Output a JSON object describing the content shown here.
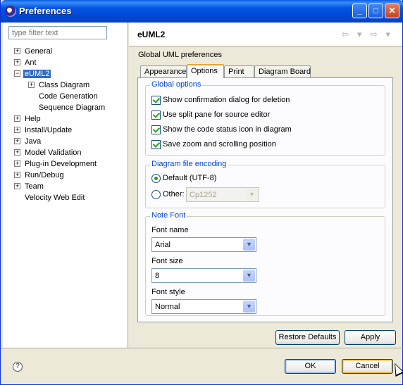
{
  "window": {
    "title": "Preferences",
    "min_label": "_",
    "max_label": "□",
    "close_label": "✕"
  },
  "filter": {
    "placeholder": "type filter text"
  },
  "tree": {
    "items": [
      {
        "label": "General",
        "expander": "+"
      },
      {
        "label": "Ant",
        "expander": "+"
      },
      {
        "label": "eUML2",
        "expander": "−"
      },
      {
        "label": "Class Diagram",
        "expander": "+"
      },
      {
        "label": "Code Generation"
      },
      {
        "label": "Sequence Diagram"
      },
      {
        "label": "Help",
        "expander": "+"
      },
      {
        "label": "Install/Update",
        "expander": "+"
      },
      {
        "label": "Java",
        "expander": "+"
      },
      {
        "label": "Model Validation",
        "expander": "+"
      },
      {
        "label": "Plug-in Development",
        "expander": "+"
      },
      {
        "label": "Run/Debug",
        "expander": "+"
      },
      {
        "label": "Team",
        "expander": "+"
      },
      {
        "label": "Velocity Web Edit"
      }
    ]
  },
  "page": {
    "title": "eUML2",
    "description": "Global UML preferences",
    "back_arrow": "⇦ ▾",
    "forward_arrow": "⇨ ▾"
  },
  "tabs": [
    {
      "label": "Appearance"
    },
    {
      "label": "Options"
    },
    {
      "label": "Print"
    },
    {
      "label": "Diagram Board"
    }
  ],
  "global_options": {
    "legend": "Global options",
    "checkboxes": [
      {
        "label": "Show confirmation dialog for deletion",
        "checked": true
      },
      {
        "label": "Use split pane for source editor",
        "checked": true
      },
      {
        "label": "Show the code status icon in diagram",
        "checked": true
      },
      {
        "label": "Save zoom and scrolling position",
        "checked": true
      }
    ]
  },
  "encoding": {
    "legend": "Diagram file encoding",
    "default_label": "Default (UTF-8)",
    "other_label": "Other:",
    "other_value": "Cp1252",
    "selected": "default"
  },
  "note_font": {
    "legend": "Note Font",
    "name_label": "Font name",
    "name_value": "Arial",
    "size_label": "Font size",
    "size_value": "8",
    "style_label": "Font style",
    "style_value": "Normal"
  },
  "buttons": {
    "restore": "Restore Defaults",
    "apply": "Apply",
    "ok": "OK",
    "cancel": "Cancel"
  },
  "help": {
    "icon": "?"
  }
}
